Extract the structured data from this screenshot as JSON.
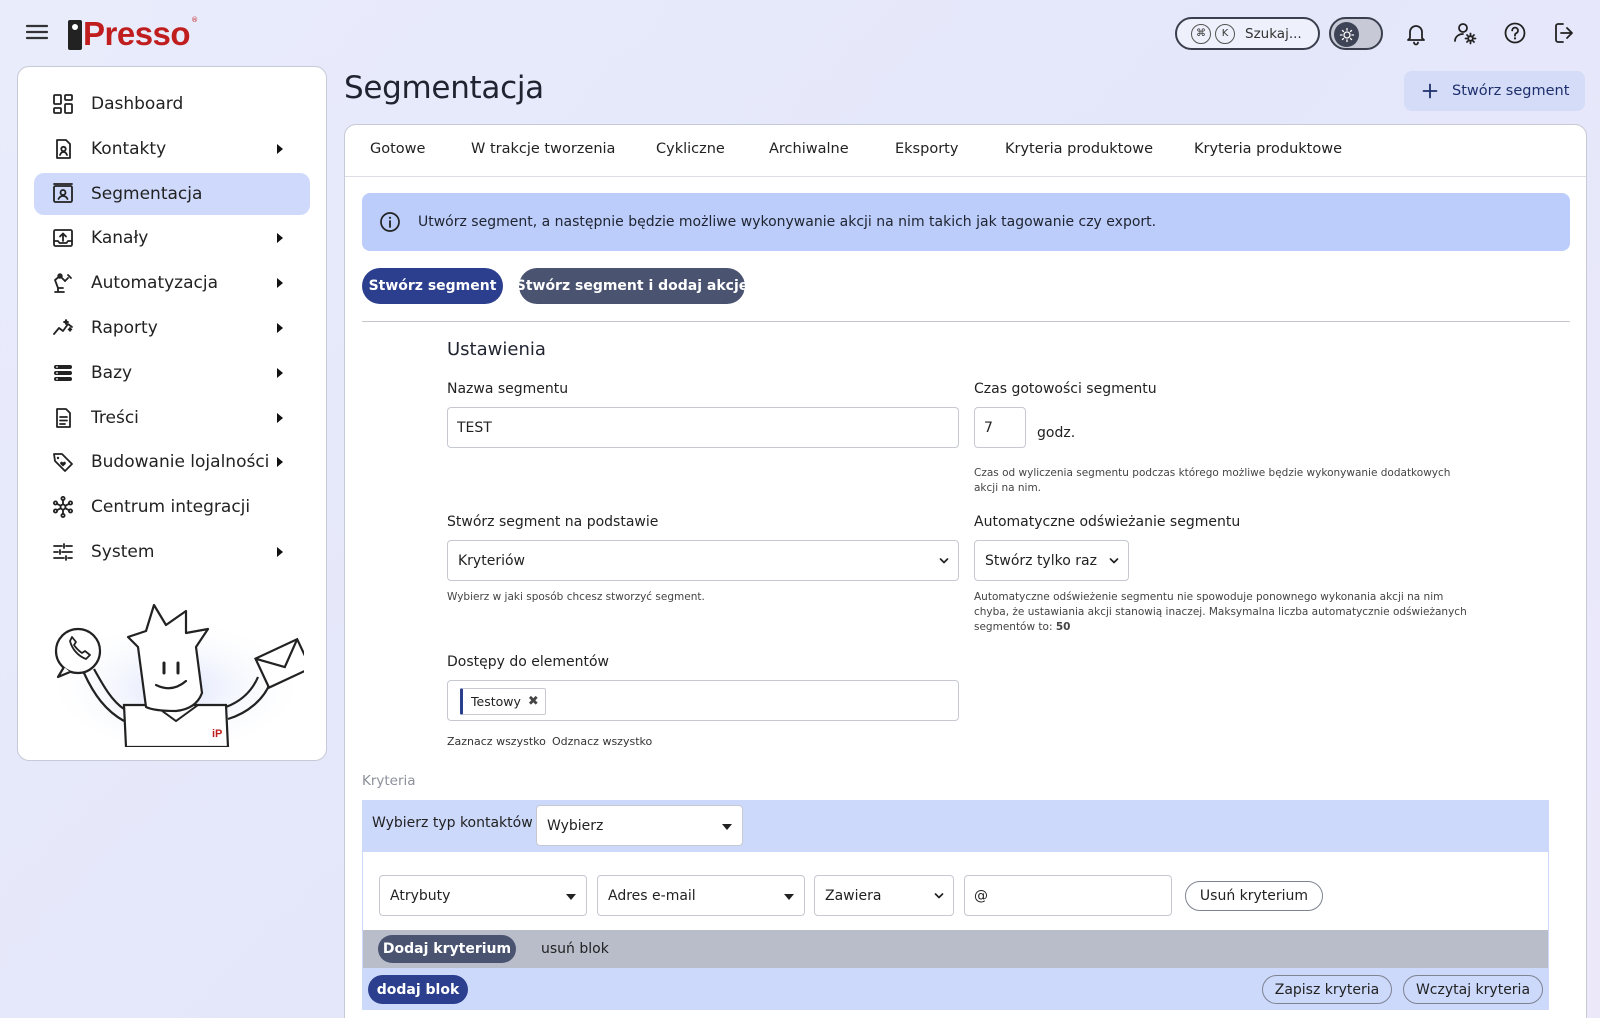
{
  "brand": {
    "logo_text": "Presso",
    "logo_reg": "®"
  },
  "topbar": {
    "search_key1": "⌘",
    "search_key2": "K",
    "search_placeholder": "Szukaj..."
  },
  "sidebar": {
    "items": [
      {
        "label": "Dashboard",
        "icon": "dashboard-icon",
        "has_submenu": false,
        "active": false
      },
      {
        "label": "Kontakty",
        "icon": "contacts-icon",
        "has_submenu": true,
        "active": false
      },
      {
        "label": "Segmentacja",
        "icon": "segmentation-icon",
        "has_submenu": false,
        "active": true
      },
      {
        "label": "Kanały",
        "icon": "channels-icon",
        "has_submenu": true,
        "active": false
      },
      {
        "label": "Automatyzacja",
        "icon": "automation-icon",
        "has_submenu": true,
        "active": false
      },
      {
        "label": "Raporty",
        "icon": "reports-icon",
        "has_submenu": true,
        "active": false
      },
      {
        "label": "Bazy",
        "icon": "database-icon",
        "has_submenu": true,
        "active": false
      },
      {
        "label": "Treści",
        "icon": "content-icon",
        "has_submenu": true,
        "active": false
      },
      {
        "label": "Budowanie lojalności",
        "icon": "loyalty-icon",
        "has_submenu": true,
        "active": false
      },
      {
        "label": "Centrum integracji",
        "icon": "integrations-icon",
        "has_submenu": false,
        "active": false
      },
      {
        "label": "System",
        "icon": "system-icon",
        "has_submenu": true,
        "active": false
      }
    ],
    "mascot_logo": "iP"
  },
  "header": {
    "title": "Segmentacja",
    "create_button": "Stwórz segment"
  },
  "tabs": [
    "Gotowe",
    "W trakcje tworzenia",
    "Cykliczne",
    "Archiwalne",
    "Eksporty",
    "Kryteria produktowe",
    "Kryteria produktowe"
  ],
  "info_banner": "Utwórz segment, a następnie będzie możliwe wykonywanie akcji na nim takich jak tagowanie czy export.",
  "actions": {
    "create": "Stwórz segment",
    "create_with_action": "Stwórz segment i dodaj akcję"
  },
  "settings": {
    "title": "Ustawienia",
    "name_label": "Nazwa segmentu",
    "name_value": "TEST",
    "ready_label": "Czas gotowości segmentu",
    "ready_value": "7",
    "ready_unit": "godz.",
    "ready_help": "Czas od wyliczenia segmentu podczas którego możliwe będzie wykonywanie dodatkowych akcji na nim.",
    "basis_label": "Stwórz segment na podstawie",
    "basis_value": "Kryteriów",
    "basis_help": "Wybierz w jaki sposób chcesz stworzyć segment.",
    "refresh_label": "Automatyczne odświeżanie segmentu",
    "refresh_value": "Stwórz tylko raz",
    "refresh_help": "Automatyczne odświeżenie segmentu nie spowoduje ponownego wykonania akcji na nim chyba, że ustawiania akcji stanowią inaczej. Maksymalna liczba automatycznie odświeżanych segmentów to:",
    "refresh_max": "50",
    "access_label": "Dostępy do elementów",
    "access_tag": "Testowy",
    "select_all": "Zaznacz wszystko",
    "deselect_all": "Odznacz wszystko"
  },
  "criteria": {
    "section_label": "Kryteria",
    "contact_type_label": "Wybierz typ kontaktów",
    "contact_type_value": "Wybierz",
    "row": {
      "category": "Atrybuty",
      "field": "Adres e-mail",
      "operator": "Zawiera",
      "value": "@",
      "remove": "Usuń kryterium"
    },
    "add_criterion": "Dodaj kryterium",
    "remove_block": "usuń blok",
    "add_block": "dodaj blok",
    "save": "Zapisz kryteria",
    "load": "Wczytaj kryteria"
  }
}
